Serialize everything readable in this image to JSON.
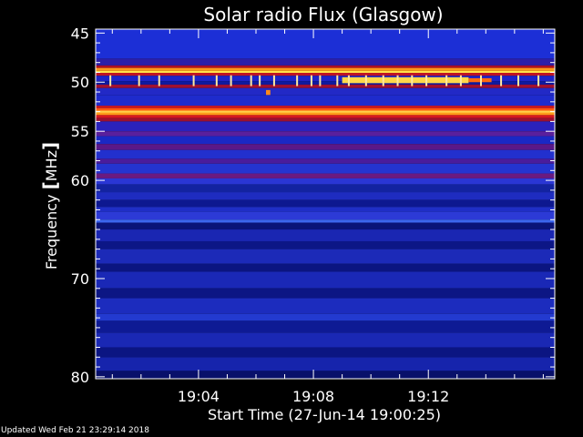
{
  "chart_data": {
    "type": "heatmap",
    "title": "Solar radio Flux (Glasgow)",
    "ylabel_prefix": "Frequency ",
    "ylabel_bracket_open": "[",
    "ylabel_unit": "MHz",
    "ylabel_bracket_close": "]",
    "xlabel": "Start Time (27-Jun-14 19:00:25)",
    "x_unit": "minutes after 19:00",
    "xlim": [
      0.42,
      16.4
    ],
    "ylim": [
      80.2,
      44.6
    ],
    "y_ticks": [
      {
        "value": 45,
        "label": "45"
      },
      {
        "value": 50,
        "label": "50"
      },
      {
        "value": 55,
        "label": "55"
      },
      {
        "value": 60,
        "label": "60"
      },
      {
        "value": 70,
        "label": "70"
      },
      {
        "value": 80,
        "label": "80"
      }
    ],
    "x_ticks": [
      {
        "value": 4,
        "label": "19:04"
      },
      {
        "value": 8,
        "label": "19:08"
      },
      {
        "value": 12,
        "label": "19:12"
      }
    ],
    "bands": [
      {
        "f1": 44.6,
        "f2": 47.6,
        "color": "#1c2fd6"
      },
      {
        "f1": 47.6,
        "f2": 48.3,
        "color": "#2c1fa8"
      },
      {
        "f1": 48.3,
        "f2": 48.55,
        "color": "#b01020"
      },
      {
        "f1": 48.55,
        "f2": 48.85,
        "color": "#ff9a1a"
      },
      {
        "f1": 48.85,
        "f2": 49.05,
        "color": "#ffe24a"
      },
      {
        "f1": 49.05,
        "f2": 49.35,
        "color": "#c01424"
      },
      {
        "f1": 49.35,
        "f2": 49.9,
        "color": "#1d24c8"
      },
      {
        "f1": 49.9,
        "f2": 50.25,
        "color": "#0f1aa0"
      },
      {
        "f1": 50.25,
        "f2": 50.6,
        "color": "#a01030"
      },
      {
        "f1": 50.6,
        "f2": 51.3,
        "color": "#2229c6"
      },
      {
        "f1": 51.3,
        "f2": 52.4,
        "color": "#1e2bcc"
      },
      {
        "f1": 52.4,
        "f2": 52.65,
        "color": "#d01822"
      },
      {
        "f1": 52.65,
        "f2": 53.05,
        "color": "#ff5a10"
      },
      {
        "f1": 53.05,
        "f2": 53.35,
        "color": "#ff9a1a"
      },
      {
        "f1": 53.35,
        "f2": 53.65,
        "color": "#d81820"
      },
      {
        "f1": 53.65,
        "f2": 54.0,
        "color": "#9a1030"
      },
      {
        "f1": 54.0,
        "f2": 55.0,
        "color": "#2a22bc"
      },
      {
        "f1": 55.0,
        "f2": 55.5,
        "color": "#5a1f9c"
      },
      {
        "f1": 55.5,
        "f2": 56.3,
        "color": "#1a28c4"
      },
      {
        "f1": 56.3,
        "f2": 56.9,
        "color": "#5a1888"
      },
      {
        "f1": 56.9,
        "f2": 57.8,
        "color": "#2230ce"
      },
      {
        "f1": 57.8,
        "f2": 58.3,
        "color": "#4a1c9c"
      },
      {
        "f1": 58.3,
        "f2": 59.3,
        "color": "#2434d0"
      },
      {
        "f1": 59.3,
        "f2": 59.8,
        "color": "#6a1a80"
      },
      {
        "f1": 59.8,
        "f2": 60.4,
        "color": "#2a36d4"
      },
      {
        "f1": 60.4,
        "f2": 61.2,
        "color": "#1323a0"
      },
      {
        "f1": 61.2,
        "f2": 62.0,
        "color": "#1e2cc0"
      },
      {
        "f1": 62.0,
        "f2": 62.7,
        "color": "#0d1890"
      },
      {
        "f1": 62.7,
        "f2": 63.2,
        "color": "#1f2ec6"
      },
      {
        "f1": 63.2,
        "f2": 64.0,
        "color": "#2c3ad6"
      },
      {
        "f1": 64.0,
        "f2": 64.3,
        "color": "#3c66ee"
      },
      {
        "f1": 64.3,
        "f2": 65.0,
        "color": "#0a1478"
      },
      {
        "f1": 65.0,
        "f2": 66.2,
        "color": "#1a26b2"
      },
      {
        "f1": 66.2,
        "f2": 67.0,
        "color": "#0c1686"
      },
      {
        "f1": 67.0,
        "f2": 68.5,
        "color": "#1c2ab8"
      },
      {
        "f1": 68.5,
        "f2": 69.3,
        "color": "#0b1580"
      },
      {
        "f1": 69.3,
        "f2": 71.0,
        "color": "#1a28b6"
      },
      {
        "f1": 71.0,
        "f2": 72.0,
        "color": "#0c1684"
      },
      {
        "f1": 72.0,
        "f2": 73.6,
        "color": "#1c2cbe"
      },
      {
        "f1": 73.6,
        "f2": 74.3,
        "color": "#233ad0"
      },
      {
        "f1": 74.3,
        "f2": 75.5,
        "color": "#0e1a94"
      },
      {
        "f1": 75.5,
        "f2": 77.0,
        "color": "#1a28b4"
      },
      {
        "f1": 77.0,
        "f2": 78.0,
        "color": "#0b1582"
      },
      {
        "f1": 78.0,
        "f2": 79.4,
        "color": "#1624ac"
      },
      {
        "f1": 79.4,
        "f2": 80.2,
        "color": "#08106a"
      }
    ],
    "features": [
      {
        "t1": 9.0,
        "t2": 13.4,
        "f1": 49.5,
        "f2": 50.1,
        "color": "#ffd84a"
      },
      {
        "t1": 13.4,
        "t2": 14.2,
        "f1": 49.6,
        "f2": 50.0,
        "color": "#ff6a10"
      },
      {
        "t1": 6.35,
        "t2": 6.5,
        "f1": 50.8,
        "f2": 51.3,
        "color": "#ff8a1a"
      },
      {
        "t1": 0.42,
        "t2": 16.4,
        "f1": 52.9,
        "f2": 53.1,
        "color": "#ffd04a"
      }
    ],
    "spikes": {
      "f1": 49.3,
      "f2": 50.4,
      "color": "#ffe8a0",
      "t": [
        0.9,
        1.9,
        2.6,
        3.8,
        4.6,
        5.1,
        5.8,
        6.1,
        6.6,
        7.4,
        7.9,
        8.2,
        8.8,
        9.2,
        9.8,
        10.4,
        10.9,
        11.4,
        11.9,
        12.6,
        13.1,
        13.8,
        14.5,
        15.1,
        15.8
      ]
    }
  },
  "footer": {
    "updated": "Updated Wed Feb 21 23:29:14 2018"
  }
}
